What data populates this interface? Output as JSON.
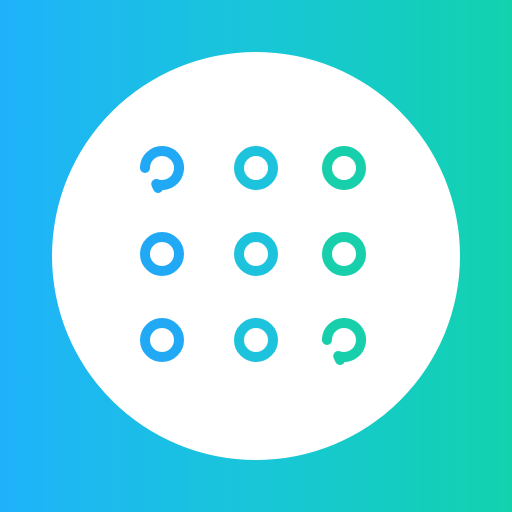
{
  "icon": {
    "name": "pattern-lock-icon",
    "colors": {
      "gradient_start": "#1fb2fb",
      "gradient_mid": "#18c6d8",
      "gradient_end": "#12d2ae",
      "disc": "#ffffff",
      "dot_left": "#22a9f6",
      "dot_middle": "#1dc3dc",
      "dot_right": "#17cfaa"
    },
    "grid": {
      "rows": 3,
      "columns": 3
    }
  }
}
